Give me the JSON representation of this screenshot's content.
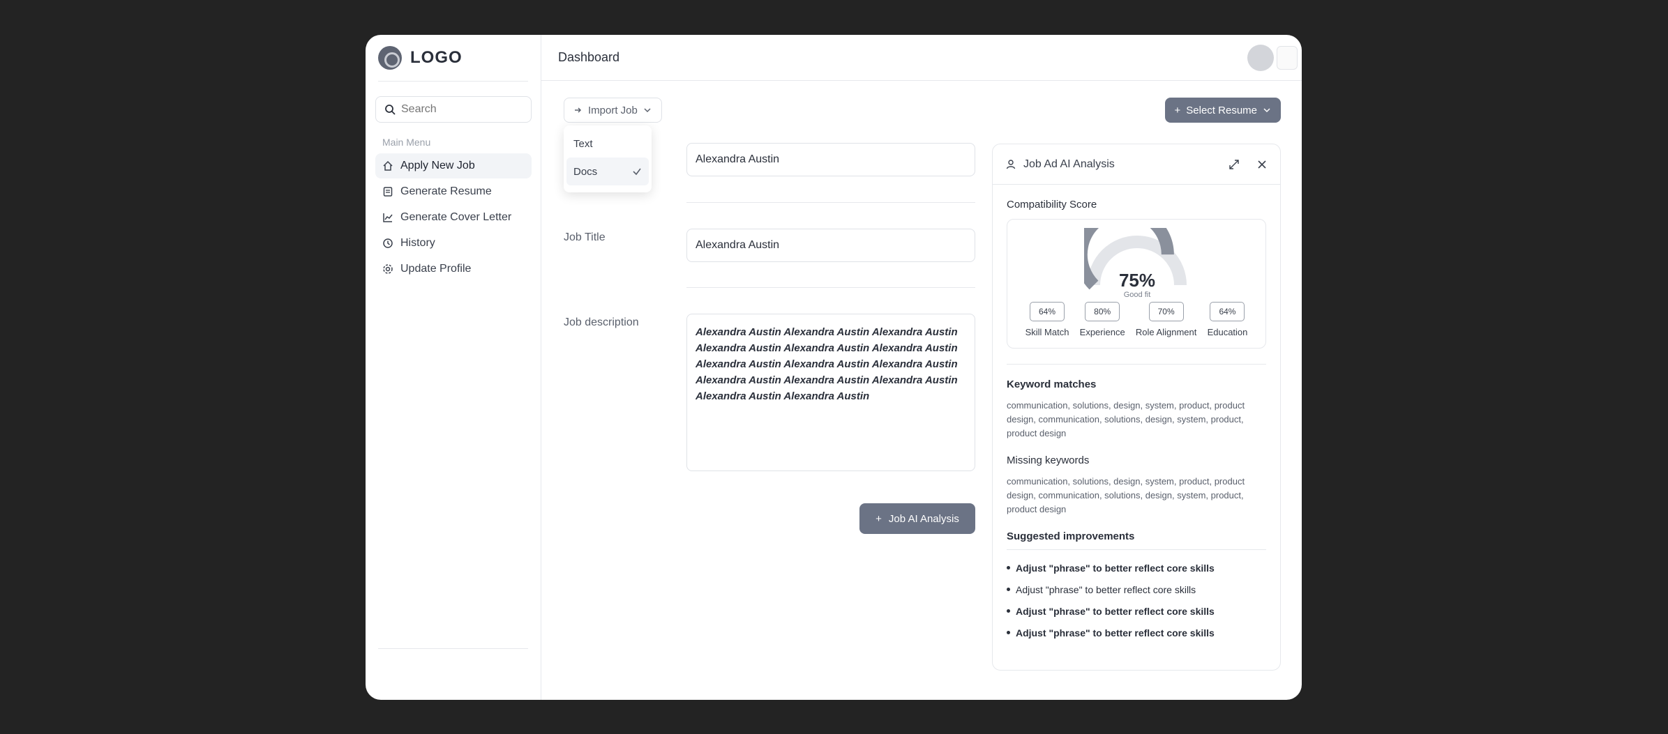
{
  "sidebar": {
    "logo": "LOGO",
    "search_placeholder": "Search",
    "menu_title": "Main Menu",
    "items": [
      {
        "label": "Apply New Job",
        "icon": "home-icon"
      },
      {
        "label": "Generate Resume",
        "icon": "document-icon"
      },
      {
        "label": "Generate Cover Letter",
        "icon": "chart-icon"
      },
      {
        "label": "History",
        "icon": "history-icon"
      },
      {
        "label": "Update Profile",
        "icon": "settings-icon"
      }
    ]
  },
  "header": {
    "title": "Dashboard"
  },
  "import": {
    "label": "Import Job",
    "options": [
      "Text",
      "Docs"
    ],
    "selected": "Docs"
  },
  "select_button": {
    "label": "Select Resume"
  },
  "form": {
    "company_value": "Alexandra Austin",
    "job_title_label": "Job Title",
    "job_title_value": "Alexandra Austin",
    "description_label": "Job description",
    "description_value": "Alexandra Austin Alexandra Austin Alexandra Austin Alexandra Austin Alexandra Austin Alexandra Austin Alexandra Austin Alexandra Austin Alexandra Austin Alexandra Austin Alexandra Austin Alexandra Austin Alexandra Austin Alexandra Austin",
    "analysis_button": "Job AI Analysis"
  },
  "panel": {
    "title": "Job Ad AI Analysis",
    "compat_title": "Compatibility Score",
    "score": "75%",
    "score_sub": "Good fit",
    "score_fraction": 0.75,
    "metrics": [
      {
        "value": "64%",
        "name": "Skill Match"
      },
      {
        "value": "80%",
        "name": "Experience"
      },
      {
        "value": "70%",
        "name": "Role Alignment"
      },
      {
        "value": "64%",
        "name": "Education"
      }
    ],
    "keywords_title": "Keyword matches",
    "keywords_text": "communication, solutions, design, system, product, product design, communication, solutions, design, system, product, product design",
    "missing_title": "Missing keywords",
    "missing_text": "communication, solutions, design, system, product, product design, communication, solutions, design, system, product, product design",
    "suggestions_title": "Suggested improvements",
    "suggestions": [
      "Adjust \"phrase\" to better reflect core skills",
      "Adjust \"phrase\" to better reflect core skills",
      "Adjust \"phrase\" to better reflect core skills",
      "Adjust \"phrase\" to better reflect core skills"
    ]
  }
}
